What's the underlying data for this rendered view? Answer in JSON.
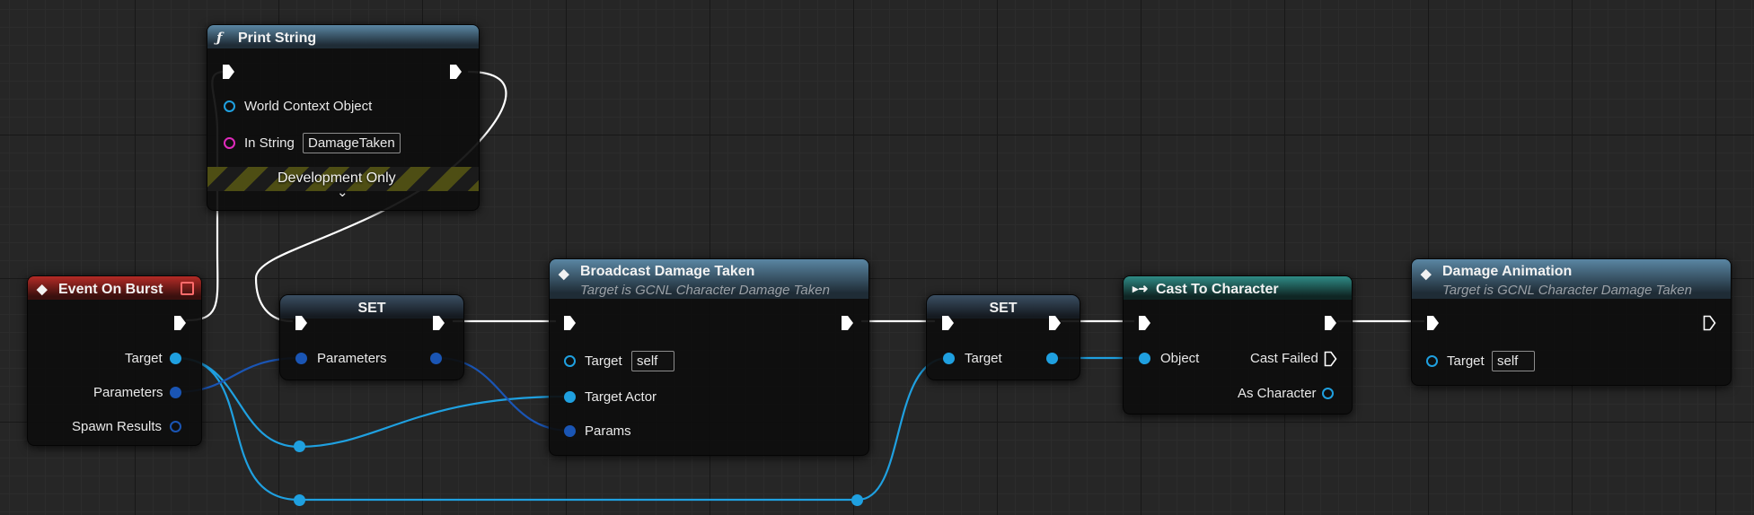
{
  "colors": {
    "exec_wire": "#ffffff",
    "object_wire": "#1fa0e0",
    "struct_wire": "#1a55b4",
    "string_pin": "#e02abc",
    "event_header": "#b52b26",
    "function_header": "#5a86a3",
    "cast_header": "#2f8c86",
    "dev_only_stripe": "#4e4e14"
  },
  "nodes": {
    "print_string": {
      "title": "Print String",
      "icon": "function-icon",
      "pins": {
        "world_context": "World Context Object",
        "in_string": "In String"
      },
      "in_string_value": "DamageTaken",
      "banner": "Development Only",
      "expand_glyph": "⌄"
    },
    "event_on_burst": {
      "title": "Event On Burst",
      "icon": "event-icon",
      "pins": {
        "target": "Target",
        "parameters": "Parameters",
        "spawn_results": "Spawn Results"
      }
    },
    "set_parameters": {
      "title": "SET",
      "pin": "Parameters"
    },
    "broadcast_damage": {
      "title": "Broadcast Damage Taken",
      "subtitle": "Target is GCNL Character Damage Taken",
      "icon": "function-icon",
      "pins": {
        "target": "Target",
        "target_actor": "Target Actor",
        "params": "Params"
      },
      "target_value": "self"
    },
    "set_target": {
      "title": "SET",
      "pin": "Target"
    },
    "cast_to_character": {
      "title": "Cast To Character",
      "icon": "cast-icon",
      "pins": {
        "object": "Object",
        "cast_failed": "Cast Failed",
        "as_character": "As Character"
      }
    },
    "damage_animation": {
      "title": "Damage Animation",
      "subtitle": "Target is GCNL Character Damage Taken",
      "icon": "function-icon",
      "pins": {
        "target": "Target"
      },
      "target_value": "self"
    }
  }
}
